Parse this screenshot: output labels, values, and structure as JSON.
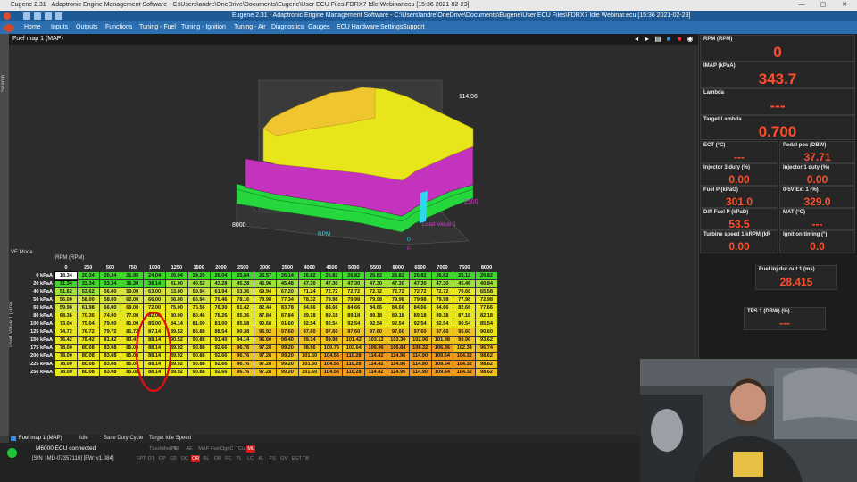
{
  "titlebar": {
    "title": "Eugene 2.31 - Adaptronic Engine Management Software - C:\\Users\\andre\\OneDrive\\Documents\\Eugene\\User ECU Files\\FDRX7 Idle Webinar.ecu   [15:36  2021-02-23]",
    "min": "—",
    "max": "▢",
    "close": "✕"
  },
  "toolbar": {
    "title": "Eugene 2.31 - Adaptronic Engine Management Software - C:\\Users\\andre\\OneDrive\\Documents\\Eugene\\User ECU Files\\FDRX7 Idle Webinar.ecu   [15:36  2021-02-23]"
  },
  "menu": [
    "Home",
    "Inputs",
    "Outputs",
    "Functions",
    "Tuning - Fuel",
    "Tuning - Ignition",
    "Tuning - Air",
    "Diagnostics",
    "Gauges",
    "ECU Hardware Settings",
    "Support"
  ],
  "search_label": "Search",
  "fuelmap": {
    "title": "Fuel map 1 (MAP)",
    "graph": {
      "peak": "114.96",
      "rpm_max": "8000",
      "rpm_label": "RPM",
      "load_max": "2500",
      "load_label": "Load Value 1",
      "zero1": "0",
      "zero2": "0"
    },
    "ve_mode": "VE Mode",
    "rpm_axis": "RPM (RPM)",
    "load_axis": "Load Value 1 (kPa)",
    "columns": [
      "0",
      "250",
      "500",
      "750",
      "1000",
      "1250",
      "1500",
      "2000",
      "2500",
      "3000",
      "3500",
      "4000",
      "4500",
      "5000",
      "5500",
      "6000",
      "6500",
      "7000",
      "7500",
      "8000"
    ],
    "rows": [
      {
        "label": "0 kPaA",
        "values": [
          "18.34",
          "20.34",
          "20.34",
          "21.96",
          "24.04",
          "26.04",
          "24.20",
          "26.04",
          "25.84",
          "26.57",
          "26.14",
          "26.82",
          "26.82",
          "26.82",
          "26.82",
          "26.82",
          "26.82",
          "26.82",
          "25.12",
          "20.82"
        ]
      },
      {
        "label": "20 kPaA",
        "values": [
          "31.34",
          "33.34",
          "33.34",
          "36.30",
          "38.14",
          "41.00",
          "40.52",
          "43.28",
          "45.28",
          "46.96",
          "45.48",
          "47.30",
          "47.30",
          "47.30",
          "47.30",
          "47.30",
          "47.30",
          "47.30",
          "45.46",
          "40.84"
        ]
      },
      {
        "label": "40 kPaA",
        "values": [
          "51.62",
          "53.62",
          "56.00",
          "59.00",
          "63.00",
          "63.00",
          "59.94",
          "61.94",
          "63.36",
          "69.94",
          "67.20",
          "71.24",
          "72.72",
          "72.72",
          "72.72",
          "72.72",
          "72.72",
          "72.72",
          "70.68",
          "65.58"
        ]
      },
      {
        "label": "50 kPaA",
        "values": [
          "56.00",
          "58.00",
          "58.00",
          "62.00",
          "66.00",
          "66.00",
          "66.94",
          "70.46",
          "78.16",
          "79.98",
          "77.34",
          "78.32",
          "79.98",
          "79.98",
          "79.98",
          "79.98",
          "79.98",
          "79.98",
          "77.98",
          "72.98"
        ]
      },
      {
        "label": "60 kPaA",
        "values": [
          "59.98",
          "61.98",
          "66.00",
          "69.00",
          "72.00",
          "75.00",
          "75.56",
          "76.30",
          "81.42",
          "82.44",
          "83.78",
          "84.66",
          "84.66",
          "84.66",
          "84.66",
          "84.66",
          "84.66",
          "84.66",
          "82.66",
          "77.66"
        ]
      },
      {
        "label": "80 kPaA",
        "values": [
          "68.36",
          "70.36",
          "74.00",
          "77.00",
          "82.00",
          "80.00",
          "80.46",
          "78.26",
          "85.36",
          "87.84",
          "87.84",
          "89.18",
          "89.18",
          "89.18",
          "89.18",
          "89.18",
          "89.18",
          "89.18",
          "87.18",
          "82.18"
        ]
      },
      {
        "label": "100 kPaA",
        "values": [
          "73.04",
          "75.04",
          "79.00",
          "81.00",
          "85.00",
          "84.14",
          "81.00",
          "81.00",
          "85.58",
          "90.68",
          "91.60",
          "92.54",
          "92.54",
          "92.54",
          "92.54",
          "92.54",
          "92.54",
          "92.54",
          "90.54",
          "85.54"
        ]
      },
      {
        "label": "125 kPaA",
        "values": [
          "74.72",
          "76.72",
          "79.72",
          "81.72",
          "87.14",
          "89.52",
          "86.88",
          "88.54",
          "90.38",
          "95.92",
          "97.60",
          "97.60",
          "97.60",
          "97.60",
          "97.60",
          "97.60",
          "97.60",
          "97.60",
          "95.60",
          "90.60"
        ]
      },
      {
        "label": "150 kPaA",
        "values": [
          "76.42",
          "78.42",
          "81.42",
          "83.42",
          "88.14",
          "90.52",
          "90.88",
          "91.40",
          "94.14",
          "96.60",
          "98.40",
          "99.14",
          "99.98",
          "101.42",
          "103.12",
          "103.30",
          "102.96",
          "101.98",
          "98.96",
          "93.62"
        ]
      },
      {
        "label": "175 kPaA",
        "values": [
          "78.00",
          "80.08",
          "83.08",
          "85.08",
          "88.14",
          "89.92",
          "90.88",
          "92.66",
          "96.76",
          "97.28",
          "99.20",
          "98.66",
          "100.76",
          "103.64",
          "106.96",
          "106.84",
          "108.32",
          "106.36",
          "102.34",
          "96.74"
        ]
      },
      {
        "label": "200 kPaA",
        "values": [
          "78.00",
          "80.08",
          "83.08",
          "85.08",
          "88.14",
          "89.92",
          "90.88",
          "92.66",
          "96.76",
          "97.28",
          "99.20",
          "101.60",
          "104.56",
          "110.28",
          "114.42",
          "114.96",
          "114.90",
          "109.64",
          "104.32",
          "98.62"
        ]
      },
      {
        "label": "225 kPaA",
        "values": [
          "78.00",
          "80.08",
          "83.08",
          "85.08",
          "88.14",
          "89.92",
          "90.88",
          "92.66",
          "96.76",
          "97.28",
          "99.20",
          "101.60",
          "104.56",
          "110.28",
          "114.42",
          "114.96",
          "114.90",
          "109.64",
          "104.32",
          "98.62"
        ]
      },
      {
        "label": "250 kPaA",
        "values": [
          "78.00",
          "80.08",
          "83.08",
          "85.08",
          "88.14",
          "89.92",
          "90.88",
          "92.66",
          "96.76",
          "97.28",
          "99.20",
          "101.60",
          "104.56",
          "110.28",
          "114.42",
          "114.96",
          "114.90",
          "109.64",
          "104.32",
          "98.62"
        ]
      }
    ]
  },
  "bottom_tabs": [
    "Fuel map 1 (MAP)",
    "Idle",
    "Base Duty Cycle",
    "Target Idle Speed"
  ],
  "status": {
    "ecu": "M6000 ECU connected",
    "serial": "[S/N : MD-07357110] [FW:  v1.084]"
  },
  "flags_top": [
    {
      "label": "TLock",
      "on": false
    },
    {
      "label": "MedPW",
      "on": false
    },
    {
      "label": "IL",
      "on": false
    },
    {
      "label": "AE",
      "on": false
    },
    {
      "label": "MAP",
      "on": false
    },
    {
      "label": "FuelC",
      "on": false
    },
    {
      "label": "IgnC",
      "on": false
    },
    {
      "label": "TCut",
      "on": false
    },
    {
      "label": "ML",
      "on": true
    }
  ],
  "flags_bottom": [
    {
      "label": "FPT",
      "on": false
    },
    {
      "label": "OT",
      "on": false
    },
    {
      "label": "OP",
      "on": false
    },
    {
      "label": "O2",
      "on": false
    },
    {
      "label": "OC",
      "on": false
    },
    {
      "label": "OR",
      "on": true
    },
    {
      "label": "RL",
      "on": false
    },
    {
      "label": "OR",
      "on": false
    },
    {
      "label": "FC",
      "on": false
    },
    {
      "label": "PL",
      "on": false
    },
    {
      "label": "LC",
      "on": false
    },
    {
      "label": "AL",
      "on": false
    },
    {
      "label": "FS",
      "on": false
    },
    {
      "label": "OV",
      "on": false
    },
    {
      "label": "EGT",
      "on": false
    },
    {
      "label": "TB",
      "on": false
    }
  ],
  "gauges": {
    "rpm": {
      "label": "RPM (RPM)",
      "value": "0"
    },
    "imap": {
      "label": "IMAP  (kPaA)",
      "value": "343.7"
    },
    "lambda": {
      "label": "Lambda",
      "value": "---"
    },
    "target_lambda": {
      "label": "Target Lambda",
      "value": "0.700"
    },
    "ect": {
      "label": "ECT (°C)",
      "value": "---"
    },
    "pedal": {
      "label": "Pedal pos (DBW)",
      "value": "37.71"
    },
    "inj3": {
      "label": "Injector 3 duty (%)",
      "value": "0.00"
    },
    "inj1": {
      "label": "Injector 1 duty (%)",
      "value": "0.00"
    },
    "fuelp": {
      "label": "Fuel P (kPaG)",
      "value": "301.0"
    },
    "ext1": {
      "label": "0-5V Ext 1 (%)",
      "value": "329.0"
    },
    "difffuelp": {
      "label": "Diff Fuel P (kPaD)",
      "value": "53.5"
    },
    "mat": {
      "label": "MAT (°C)",
      "value": "---"
    },
    "turbine": {
      "label": "Turbine speed 1 kRPM (kR",
      "value": "0.00"
    },
    "ign": {
      "label": "Ignition timing (°)",
      "value": "0.0"
    },
    "injdur": {
      "label": "Fuel inj dur out 1 (ms)",
      "value": "28.415"
    },
    "tps": {
      "label": "TPS 1 (DBW) (%)",
      "value": "---"
    }
  },
  "colors": {
    "accent_value": "#ff4d2e",
    "menu_blue": "#2b6fb0",
    "status_on": "#1cc63a"
  }
}
